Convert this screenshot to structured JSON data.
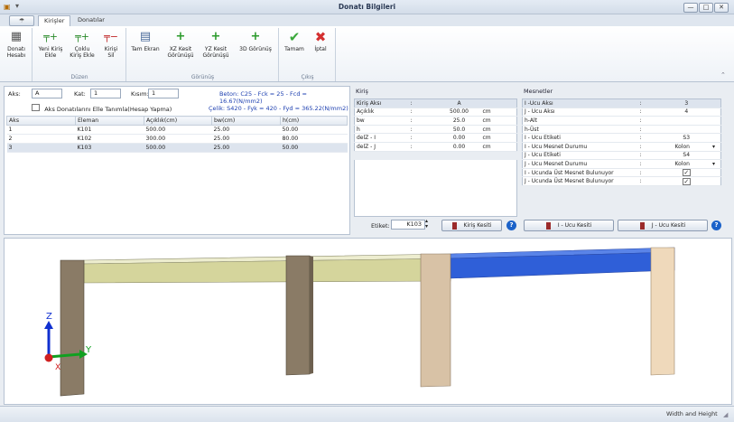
{
  "window": {
    "title": "Donatı Bilgileri",
    "min": "—",
    "max": "□",
    "close": "✕"
  },
  "tabs": [
    "Kirişler",
    "Donatılar"
  ],
  "app_menu_icon": "app-menu-icon",
  "ribbon": {
    "groups": [
      {
        "label": "",
        "buttons": [
          {
            "label1": "Donatı",
            "label2": "Hesabı",
            "icon": "calculator-icon"
          }
        ]
      },
      {
        "label": "Düzen",
        "buttons": [
          {
            "label1": "Yeni Kiriş",
            "label2": "Ekle",
            "icon": "beam-add-icon"
          },
          {
            "label1": "Çoklu",
            "label2": "Kiriş Ekle",
            "icon": "multi-beam-add-icon"
          },
          {
            "label1": "Kirişi",
            "label2": "Sil",
            "icon": "beam-delete-icon"
          }
        ]
      },
      {
        "label": "Görünüş",
        "buttons": [
          {
            "label1": "Tam Ekran",
            "label2": "",
            "icon": "fullscreen-icon"
          },
          {
            "label1": "XZ Kesit",
            "label2": "Görünüşü",
            "icon": "plus-icon"
          },
          {
            "label1": "YZ Kesit",
            "label2": "Görünüşü",
            "icon": "plus-icon"
          },
          {
            "label1": "3D Görünüş",
            "label2": "",
            "icon": "plus-icon"
          }
        ]
      },
      {
        "label": "Çıkış",
        "buttons": [
          {
            "label1": "Tamam",
            "label2": "",
            "icon": "check-icon"
          },
          {
            "label1": "İptal",
            "label2": "",
            "icon": "cross-icon"
          }
        ]
      }
    ]
  },
  "form": {
    "aks_label": "Aks:",
    "aks_value": "A",
    "kat_label": "Kat:",
    "kat_value": "1",
    "kisim_label": "Kısım:",
    "kisim_value": "1",
    "beton_text": "Beton: C25 - Fck = 25 - Fcd = 16.67(N/mm2)",
    "celik_text": "Çelik: S420 - Fyk = 420 - Fyd = 365.22(N/mm2)",
    "manual_checkbox_label": "Aks Donatılarını Elle Tanımla(Hesap Yapma)"
  },
  "beam_table": {
    "headers": [
      "Aks",
      "Eleman",
      "Açıklık(cm)",
      "bw(cm)",
      "h(cm)"
    ],
    "rows": [
      [
        "1",
        "K101",
        "500.00",
        "25.00",
        "50.00"
      ],
      [
        "2",
        "K102",
        "300.00",
        "25.00",
        "80.00"
      ],
      [
        "3",
        "K103",
        "500.00",
        "25.00",
        "50.00"
      ]
    ]
  },
  "kiris_panel": {
    "title": "Kiriş",
    "rows": [
      [
        "Kiriş Aksı",
        ":",
        "A",
        ""
      ],
      [
        "Açıklık",
        ":",
        "500.00",
        "cm"
      ],
      [
        "bw",
        ":",
        "25.0",
        "cm"
      ],
      [
        "h",
        ":",
        "50.0",
        "cm"
      ],
      [
        "delZ - I",
        ":",
        "0.00",
        "cm"
      ],
      [
        "delZ - J",
        ":",
        "0.00",
        "cm"
      ]
    ],
    "etiket_label": "Etiket:",
    "etiket_value": "K103",
    "section_button": "Kiriş Kesiti"
  },
  "mesnet_panel": {
    "title": "Mesnetler",
    "rows": [
      [
        "I -Ucu Aksı",
        ":",
        "3"
      ],
      [
        "J - Ucu Aksı",
        ":",
        "4"
      ],
      [
        "h-Alt",
        ":",
        ""
      ],
      [
        "h-Üst",
        ":",
        ""
      ],
      [
        "I - Ucu Etiketi",
        ":",
        "S3"
      ],
      [
        "I - Ucu Mesnet Durumu",
        ":",
        "Kolon"
      ],
      [
        "J - Ucu Etiketi",
        ":",
        "S4"
      ],
      [
        "J - Ucu Mesnet Durumu",
        ":",
        "Kolon"
      ],
      [
        "I - Ucunda Üst Mesnet Bulunuyor",
        ":",
        "✓"
      ],
      [
        "J - Ucunda Üst Mesnet Bulunuyor",
        ":",
        "✓"
      ]
    ],
    "i_button": "I - Ucu Kesiti",
    "j_button": "J - Ucu Kesiti"
  },
  "viewport": {
    "axis_z": "Z",
    "axis_y": "Y",
    "axis_x": "X"
  },
  "status": {
    "text": "Width and Height"
  }
}
